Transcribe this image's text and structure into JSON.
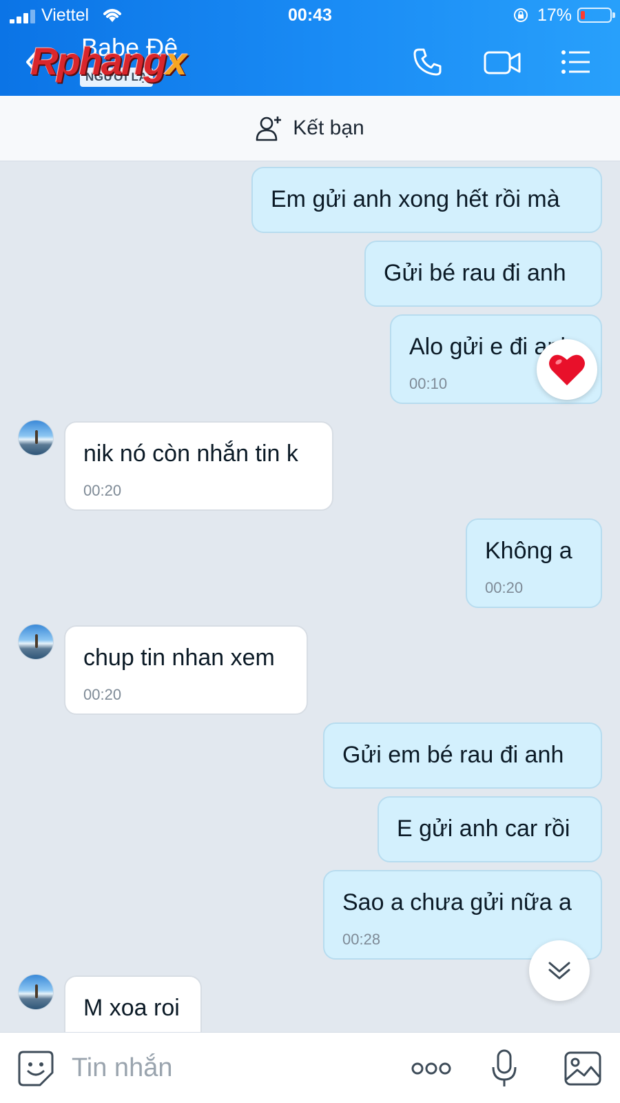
{
  "status_bar": {
    "carrier": "Viettel",
    "time": "00:43",
    "battery_percent": "17%"
  },
  "header": {
    "contact_name": "Babe Đệ",
    "badge": "NGƯỜI LẠ",
    "watermark": "Rphangx",
    "icons": [
      "back-icon",
      "phone-icon",
      "video-call-icon",
      "menu-list-icon"
    ]
  },
  "friend_bar": {
    "label": "Kết bạn",
    "icon": "add-friend-icon"
  },
  "messages": [
    {
      "direction": "out",
      "text": "Em gửi anh xong hết rồi mà",
      "time": ""
    },
    {
      "direction": "out",
      "text": "Gửi bé rau đi anh",
      "time": ""
    },
    {
      "direction": "out",
      "text": "Alo gửi e đi anh",
      "time": "00:10",
      "reaction": "heart"
    },
    {
      "direction": "in",
      "text": "nik nó còn nhắn tin k",
      "time": "00:20"
    },
    {
      "direction": "out",
      "text": "Không a",
      "time": "00:20"
    },
    {
      "direction": "in",
      "text": "chup tin nhan xem",
      "time": "00:20"
    },
    {
      "direction": "out",
      "text": "Gửi em bé rau đi anh",
      "time": ""
    },
    {
      "direction": "out",
      "text": "E gửi anh car rồi",
      "time": ""
    },
    {
      "direction": "out",
      "text": "Sao a chưa gửi nữa a",
      "time": "00:28"
    },
    {
      "direction": "in",
      "text": "M xoa roi",
      "time": ""
    }
  ],
  "input_bar": {
    "placeholder": "Tin nhắn",
    "icons": [
      "sticker-icon",
      "more-icon",
      "microphone-icon",
      "image-icon"
    ]
  },
  "colors": {
    "header_start": "#0b74e6",
    "header_end": "#28a0fb",
    "outgoing_bubble": "#d3f0fd",
    "incoming_bubble": "#ffffff",
    "chat_background": "#e2e8ef"
  }
}
